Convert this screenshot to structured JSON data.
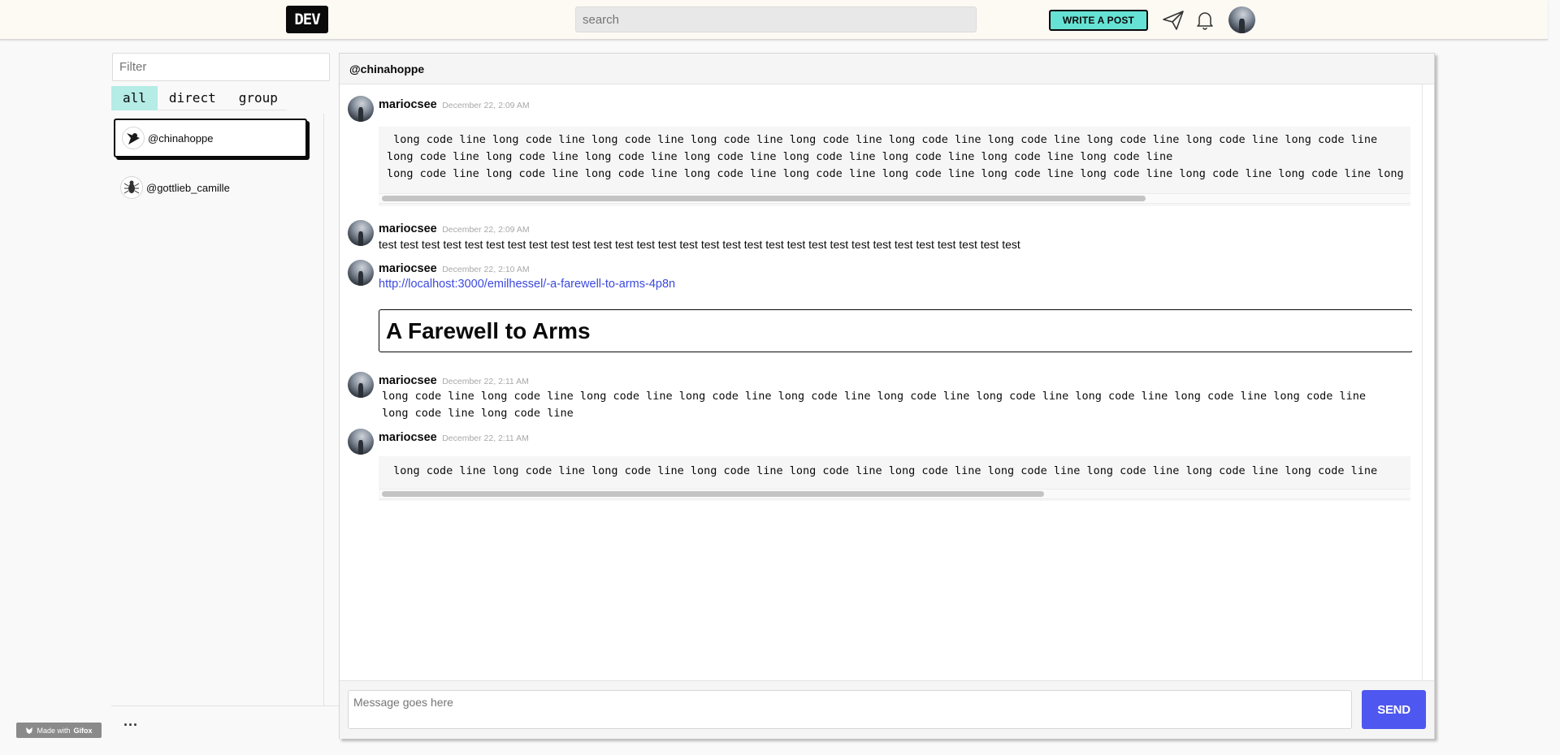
{
  "header": {
    "logo": "DEV",
    "search_placeholder": "search",
    "write_post_label": "WRITE A POST",
    "icons": [
      "paper-plane-icon",
      "bell-icon",
      "user-avatar"
    ]
  },
  "sidebar": {
    "filter_placeholder": "Filter",
    "tabs": [
      {
        "label": "all",
        "active": true
      },
      {
        "label": "direct",
        "active": false
      },
      {
        "label": "group",
        "active": false
      }
    ],
    "channels": [
      {
        "name": "@chinahoppe",
        "active": true,
        "icon": "bird-icon"
      },
      {
        "name": "@gottlieb_camille",
        "active": false,
        "icon": "bug-icon"
      }
    ],
    "more_label": "..."
  },
  "chat": {
    "channel_title": "@chinahoppe",
    "messages": [
      {
        "user": "mariocsee",
        "time": "December 22, 2:09 AM",
        "type": "code",
        "lines": [
          " long code line long code line long code line long code line long code line long code line long code line long code line long code line long code line",
          "long code line long code line long code line long code line long code line long code line long code line long code line",
          "long code line long code line long code line long code line long code line long code line long code line long code line long code line long code line long code line"
        ]
      },
      {
        "user": "mariocsee",
        "time": "December 22, 2:09 AM",
        "type": "text",
        "text": "test test test test test test test test test test test test test test test test test test test test test test test test test test test test test test"
      },
      {
        "user": "mariocsee",
        "time": "December 22, 2:10 AM",
        "type": "link",
        "url": "http://localhost:3000/emilhessel/-a-farewell-to-arms-4p8n",
        "card_title": "A Farewell to Arms"
      },
      {
        "user": "mariocsee",
        "time": "December 22, 2:11 AM",
        "type": "inline-code",
        "text": "long code line long code line long code line long code line long code line long code line long code line long code line long code line long code line long code line long code line"
      },
      {
        "user": "mariocsee",
        "time": "December 22, 2:11 AM",
        "type": "code",
        "lines": [
          " long code line long code line long code line long code line long code line long code line long code line long code line long code line long code line"
        ]
      }
    ],
    "composer_placeholder": "Message goes here",
    "send_label": "SEND"
  },
  "badge": {
    "made_with": "Made with",
    "brand": "Gifox"
  },
  "colors": {
    "accent_teal": "#66e2d5",
    "send_blue": "#4e57ef",
    "link_blue": "#3b49df",
    "topbar_bg": "#fdf9f3"
  }
}
